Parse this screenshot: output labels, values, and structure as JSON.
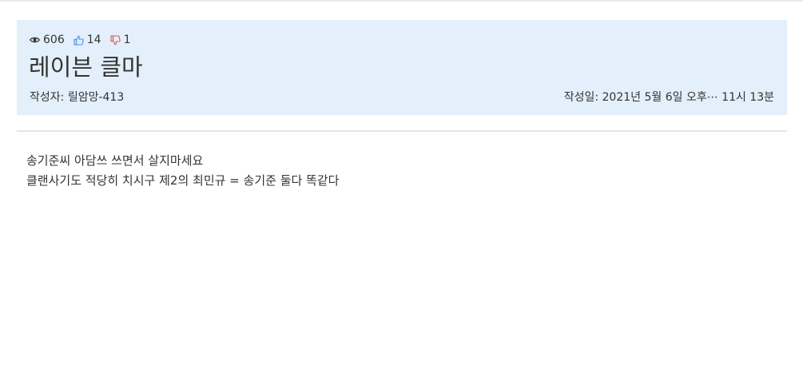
{
  "post": {
    "stats": {
      "views": "606",
      "likes": "14",
      "dislikes": "1",
      "icons": {
        "views": "eye-icon",
        "likes": "thumbs-up-icon",
        "dislikes": "thumbs-down-icon"
      }
    },
    "title": "레이븐 클마",
    "author_label": "작성자:",
    "author": "릴암망-413",
    "date_label": "작성일:",
    "date": "2021년 5월 6일 오후⋯ 11시 13분"
  },
  "body": {
    "lines": [
      "송기준씨 아담쓰 쓰면서 살지마세요",
      "클랜사기도 적당히 치시구 제2의 최민규 = 송기준 둘다 똑같다"
    ]
  },
  "colors": {
    "header_bg": "#e3effb",
    "like_icon": "#4a90e2",
    "dislike_icon": "#e05555",
    "text": "#333333"
  }
}
